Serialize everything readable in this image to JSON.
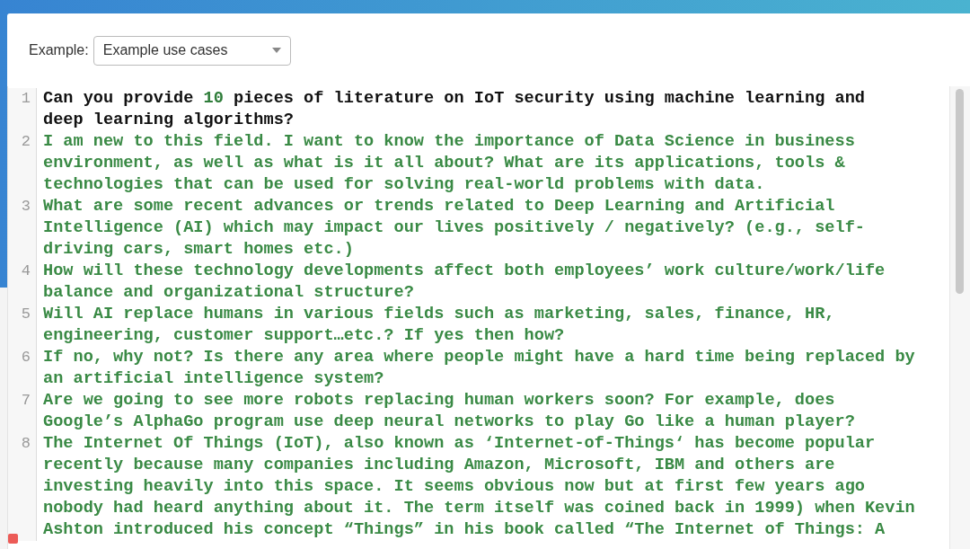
{
  "example_picker": {
    "label": "Example:",
    "value": "Example use cases"
  },
  "editor": {
    "lines": [
      {
        "number": "1",
        "segments": [
          {
            "kind": "text",
            "text": "Can you provide "
          },
          {
            "kind": "number",
            "text": "10"
          },
          {
            "kind": "text",
            "text": " pieces of literature on IoT security using machine learning and deep learning algorithms?"
          }
        ]
      },
      {
        "number": "2",
        "segments": [
          {
            "kind": "string",
            "text": "I am new to this field. I want to know the importance of Data Science in business environment, as well as what is it all about? What are its applications, tools & technologies that can be used for solving real-world problems with data."
          }
        ]
      },
      {
        "number": "3",
        "segments": [
          {
            "kind": "string",
            "text": "What are some recent advances or trends related to Deep Learning and Artificial Intelligence (AI) which may impact our lives positively / negatively? (e.g., self-driving cars, smart homes etc.)"
          }
        ]
      },
      {
        "number": "4",
        "segments": [
          {
            "kind": "string",
            "text": "How will these technology developments affect both employees’ work culture/work/life balance and organizational structure?"
          }
        ]
      },
      {
        "number": "5",
        "segments": [
          {
            "kind": "string",
            "text": "Will AI replace humans in various fields such as marketing, sales, finance, HR, engineering, customer support…etc.? If yes then how?"
          }
        ]
      },
      {
        "number": "6",
        "segments": [
          {
            "kind": "string",
            "text": "If no, why not? Is there any area where people might have a hard time being replaced by an artificial intelligence system?"
          }
        ]
      },
      {
        "number": "7",
        "segments": [
          {
            "kind": "string",
            "text": "Are we going to see more robots replacing human workers soon? For example, does Google’s AlphaGo program use deep neural networks to play Go like a human player?"
          }
        ]
      },
      {
        "number": "8",
        "segments": [
          {
            "kind": "string",
            "text": "The Internet Of Things (IoT), also known as ‘Internet-of-Things‘ has become popular recently because many companies including Amazon, Microsoft, IBM and others are investing heavily into this space. It seems obvious now but at first few years ago nobody had heard anything about it. The term itself was coined back in 1999) when Kevin Ashton introduced his concept “Things” in his book called “The Internet of Things: A"
          }
        ]
      }
    ]
  }
}
